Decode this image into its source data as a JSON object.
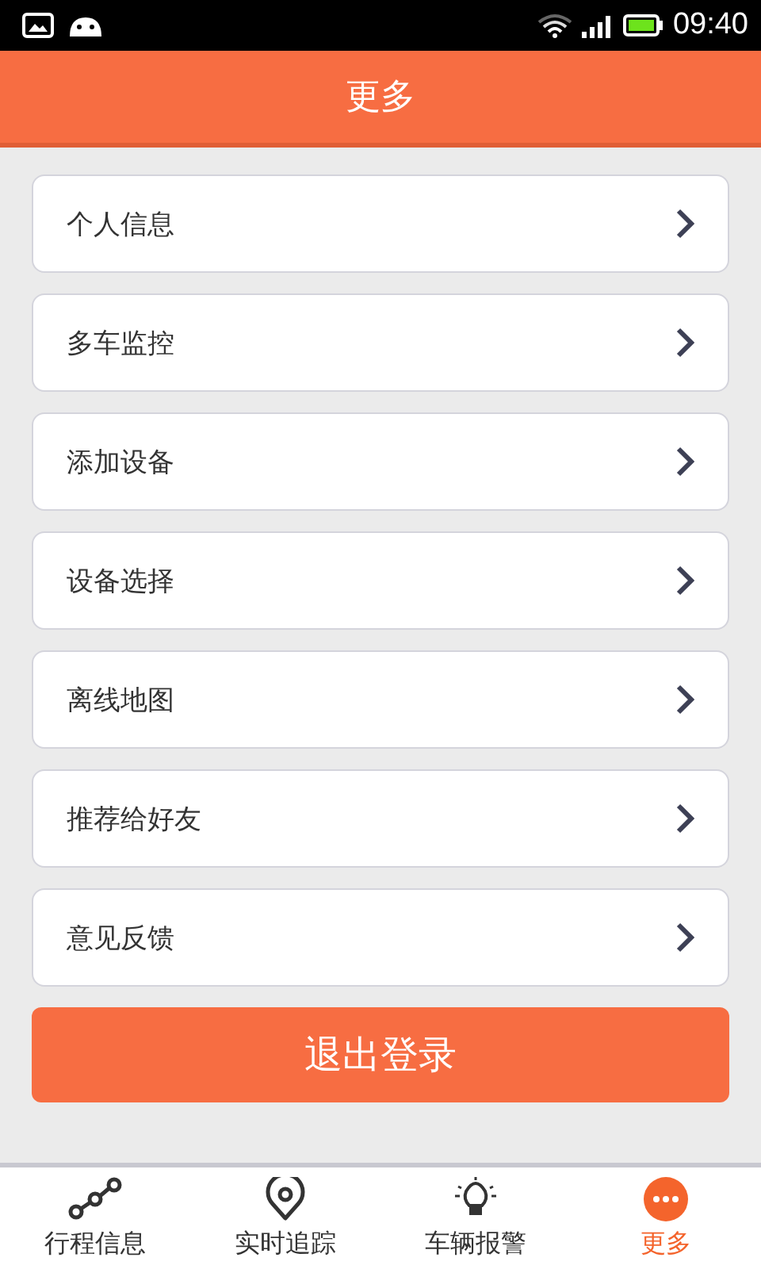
{
  "status_bar": {
    "time": "09:40"
  },
  "header": {
    "title": "更多"
  },
  "menu_items": [
    {
      "label": "个人信息"
    },
    {
      "label": "多车监控"
    },
    {
      "label": "添加设备"
    },
    {
      "label": "设备选择"
    },
    {
      "label": "离线地图"
    },
    {
      "label": "推荐给好友"
    },
    {
      "label": "意见反馈"
    }
  ],
  "logout_button": {
    "label": "退出登录"
  },
  "tabs": [
    {
      "label": "行程信息",
      "kind": "route",
      "selected": false
    },
    {
      "label": "实时追踪",
      "kind": "pin",
      "selected": false
    },
    {
      "label": "车辆报警",
      "kind": "bulb",
      "selected": false
    },
    {
      "label": "更多",
      "kind": "more",
      "selected": true
    }
  ]
}
